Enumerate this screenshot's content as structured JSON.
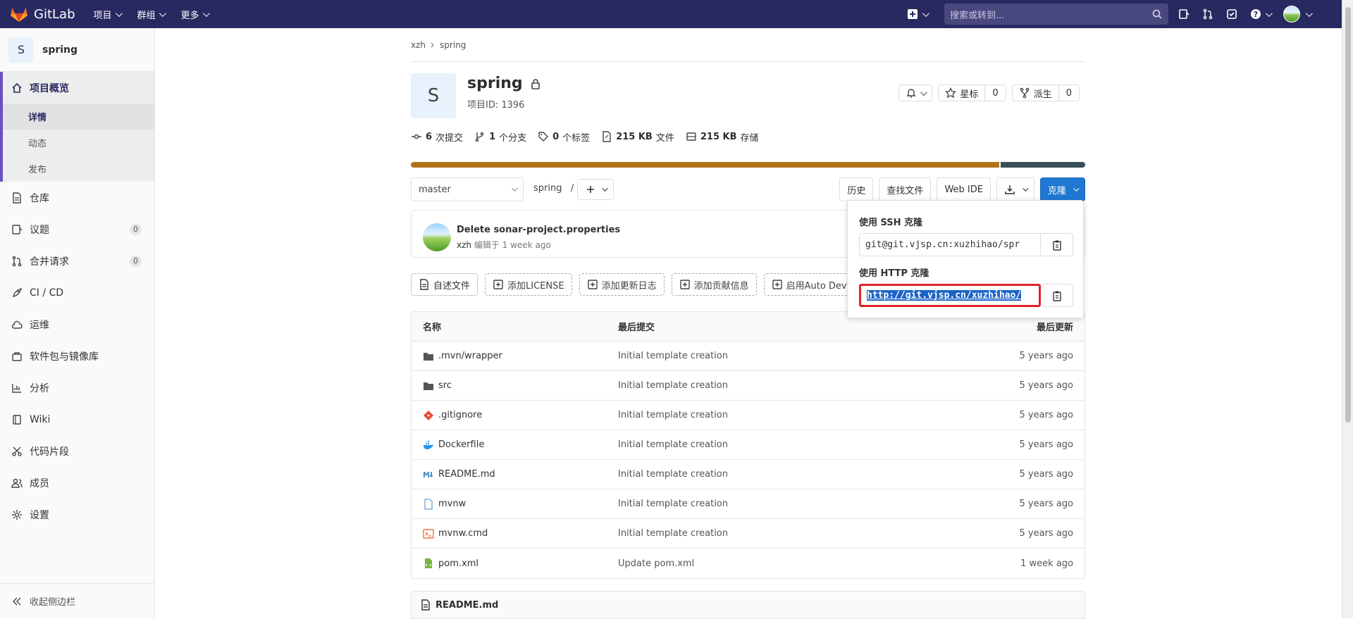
{
  "navbar": {
    "brand": "GitLab",
    "menu": [
      {
        "label": "项目"
      },
      {
        "label": "群组"
      },
      {
        "label": "更多"
      }
    ],
    "search_placeholder": "搜索或转到...",
    "colors": {
      "background": "#292961",
      "search": "#48477e"
    }
  },
  "sidebar": {
    "project_avatar": "S",
    "project_name": "spring",
    "overview": {
      "label": "项目概览",
      "icon": "home-icon",
      "subitems": [
        "详情",
        "动态",
        "发布"
      ],
      "active_subitem": "详情"
    },
    "items": [
      {
        "label": "仓库",
        "icon": "file-icon"
      },
      {
        "label": "议题",
        "icon": "issues-icon",
        "badge": "0"
      },
      {
        "label": "合并请求",
        "icon": "merge-request-icon",
        "badge": "0"
      },
      {
        "label": "CI / CD",
        "icon": "rocket-icon"
      },
      {
        "label": "运维",
        "icon": "cloud-icon"
      },
      {
        "label": "软件包与镜像库",
        "icon": "package-icon"
      },
      {
        "label": "分析",
        "icon": "chart-icon"
      },
      {
        "label": "Wiki",
        "icon": "book-icon"
      },
      {
        "label": "代码片段",
        "icon": "scissors-icon"
      },
      {
        "label": "成员",
        "icon": "users-icon"
      },
      {
        "label": "设置",
        "icon": "gear-icon"
      }
    ],
    "collapse_label": "收起侧边栏"
  },
  "breadcrumb": [
    "xzh",
    "spring"
  ],
  "project": {
    "avatar": "S",
    "name": "spring",
    "id_label": "项目ID: 1396",
    "star_label": "星标",
    "star_count": "0",
    "fork_label": "派生",
    "fork_count": "0"
  },
  "stats": [
    {
      "value": "6",
      "label": "次提交",
      "icon": "commit-icon"
    },
    {
      "value": "1",
      "label": "个分支",
      "icon": "branch-icon"
    },
    {
      "value": "0",
      "label": "个标签",
      "icon": "tag-icon"
    },
    {
      "value": "215 KB",
      "label": "文件",
      "icon": "file-size-icon"
    },
    {
      "value": "215 KB",
      "label": "存储",
      "icon": "storage-icon"
    }
  ],
  "language_bar": [
    {
      "color": "#b07219",
      "share": 0.874
    },
    {
      "color": "#384d54",
      "share": 0.126
    }
  ],
  "toolbar": {
    "branch": "master",
    "path": "spring",
    "path_separator": "/",
    "history": "历史",
    "find_file": "查找文件",
    "web_ide": "Web IDE",
    "clone": "克隆"
  },
  "last_commit": {
    "title": "Delete sonar-project.properties",
    "author": "xzh",
    "meta": "编辑于 1 week ago"
  },
  "quick_actions": [
    "自述文件",
    "添加LICENSE",
    "添加更新日志",
    "添加贡献信息",
    "启用Auto Dev"
  ],
  "files": {
    "headers": [
      "名称",
      "最后提交",
      "最后更新"
    ],
    "rows": [
      {
        "name": ".mvn/wrapper",
        "icon": "folder-icon",
        "commit": "Initial template creation",
        "updated": "5 years ago"
      },
      {
        "name": "src",
        "icon": "folder-icon",
        "commit": "Initial template creation",
        "updated": "5 years ago"
      },
      {
        "name": ".gitignore",
        "icon": "git-icon",
        "commit": "Initial template creation",
        "updated": "5 years ago"
      },
      {
        "name": "Dockerfile",
        "icon": "docker-icon",
        "commit": "Initial template creation",
        "updated": "5 years ago"
      },
      {
        "name": "README.md",
        "icon": "markdown-icon",
        "commit": "Initial template creation",
        "updated": "5 years ago"
      },
      {
        "name": "mvnw",
        "icon": "file-icon",
        "commit": "Initial template creation",
        "updated": "5 years ago"
      },
      {
        "name": "mvnw.cmd",
        "icon": "terminal-icon",
        "commit": "Initial template creation",
        "updated": "5 years ago"
      },
      {
        "name": "pom.xml",
        "icon": "xml-file-icon",
        "commit": "Update pom.xml",
        "updated": "1 week ago"
      }
    ]
  },
  "readme_title": "README.md",
  "clone_dropdown": {
    "ssh_label": "使用 SSH 克隆",
    "ssh_url": "git@git.vjsp.cn:xuzhihao/spr",
    "http_label": "使用 HTTP 克隆",
    "http_url": "http://git.vjsp.cn/xuzhihao/"
  }
}
